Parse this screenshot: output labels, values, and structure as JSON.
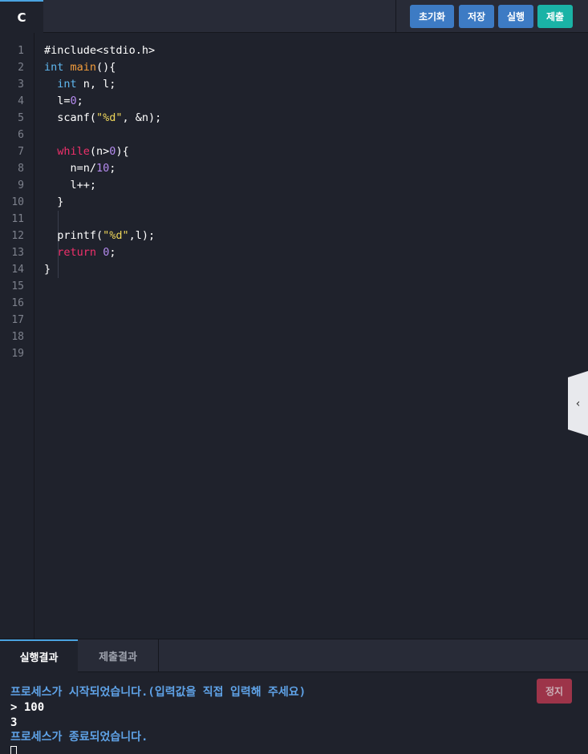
{
  "editor_tab": {
    "label": "C"
  },
  "toolbar": {
    "reset_label": "초기화",
    "save_label": "저장",
    "run_label": "실행",
    "submit_label": "제출"
  },
  "line_numbers": [
    "1",
    "2",
    "3",
    "4",
    "5",
    "6",
    "7",
    "8",
    "9",
    "10",
    "11",
    "12",
    "13",
    "14",
    "15",
    "16",
    "17",
    "18",
    "19"
  ],
  "code_lines": [
    [
      {
        "t": "#include<stdio.h>",
        "c": ""
      }
    ],
    [
      {
        "t": "int",
        "c": "kw-b"
      },
      {
        "t": " ",
        "c": ""
      },
      {
        "t": "main",
        "c": "kw-o"
      },
      {
        "t": "(){",
        "c": ""
      }
    ],
    [
      {
        "t": "  ",
        "c": ""
      },
      {
        "t": "int",
        "c": "kw-b"
      },
      {
        "t": " n, l;",
        "c": ""
      }
    ],
    [
      {
        "t": "  l=",
        "c": ""
      },
      {
        "t": "0",
        "c": "num"
      },
      {
        "t": ";",
        "c": ""
      }
    ],
    [
      {
        "t": "  scanf(",
        "c": ""
      },
      {
        "t": "\"%d\"",
        "c": "str"
      },
      {
        "t": ", &n);",
        "c": ""
      }
    ],
    [
      {
        "t": "",
        "c": ""
      }
    ],
    [
      {
        "t": "  ",
        "c": ""
      },
      {
        "t": "while",
        "c": "kw-p"
      },
      {
        "t": "(n>",
        "c": ""
      },
      {
        "t": "0",
        "c": "num"
      },
      {
        "t": "){",
        "c": ""
      }
    ],
    [
      {
        "t": "    n=n/",
        "c": ""
      },
      {
        "t": "10",
        "c": "num"
      },
      {
        "t": ";",
        "c": ""
      }
    ],
    [
      {
        "t": "    l++;",
        "c": ""
      }
    ],
    [
      {
        "t": "  }",
        "c": ""
      }
    ],
    [
      {
        "t": "",
        "c": ""
      }
    ],
    [
      {
        "t": "  printf(",
        "c": ""
      },
      {
        "t": "\"%d\"",
        "c": "str"
      },
      {
        "t": ",l);",
        "c": ""
      }
    ],
    [
      {
        "t": "  ",
        "c": ""
      },
      {
        "t": "return",
        "c": "kw-p"
      },
      {
        "t": " ",
        "c": ""
      },
      {
        "t": "0",
        "c": "num"
      },
      {
        "t": ";",
        "c": ""
      }
    ],
    [
      {
        "t": "}",
        "c": ""
      }
    ]
  ],
  "panel_tabs": {
    "run_result": "실행결과",
    "submit_result": "제출결과"
  },
  "console": {
    "stop_label": "정지",
    "lines": [
      {
        "text": "프로세스가 시작되었습니다.(입력값을 직접 입력해 주세요)",
        "kind": "sys"
      },
      {
        "text": "> 100",
        "kind": "usr"
      },
      {
        "text": "3",
        "kind": "usr"
      },
      {
        "text": "프로세스가 종료되었습니다.",
        "kind": "sys"
      }
    ]
  }
}
